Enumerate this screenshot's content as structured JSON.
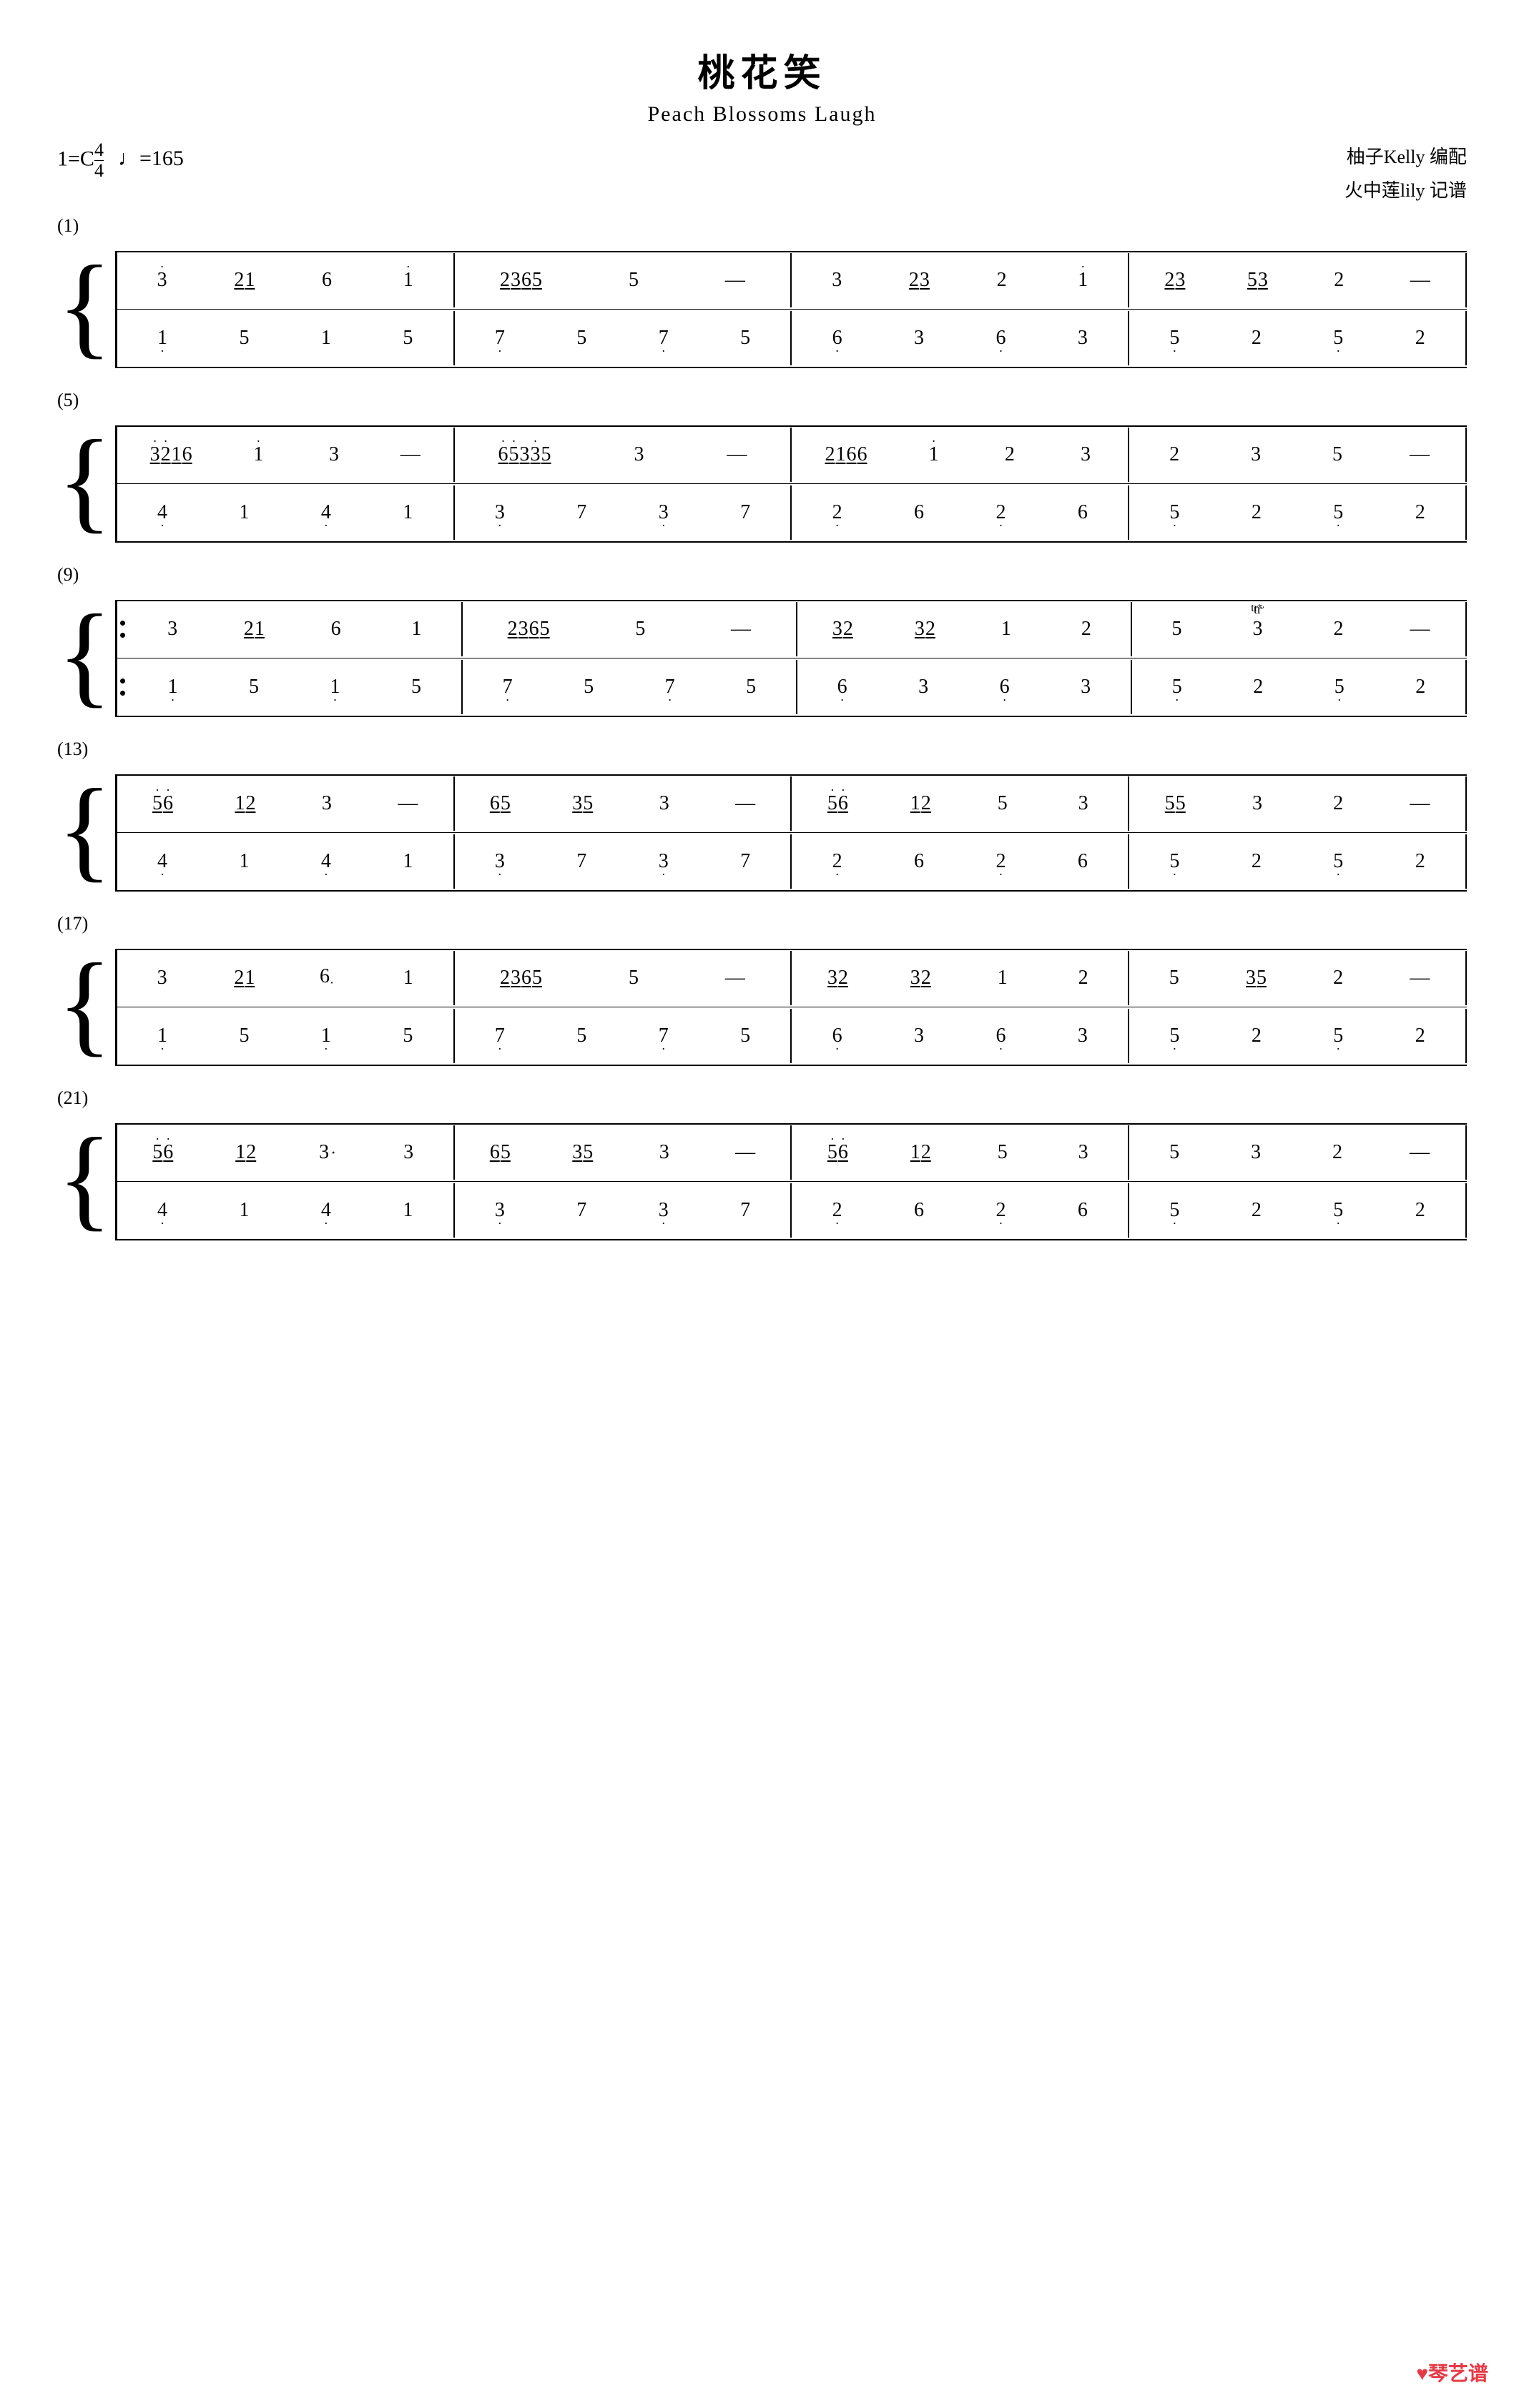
{
  "title": {
    "chinese": "桃花笑",
    "english": "Peach Blossoms Laugh",
    "key": "1=C",
    "time_num": "4",
    "time_den": "4",
    "tempo": "♩=165",
    "arranger": "柚子Kelly 编配",
    "transcriber": "火中莲lily 记谱"
  },
  "sections": [
    {
      "label": "(1)",
      "treble": [
        [
          "3·",
          "2̲1̲",
          "6",
          "1·",
          "|",
          "2̲3̲6̲5̲",
          "5",
          "—",
          "|",
          "3",
          "2̲3̲",
          "2",
          "1·",
          "|",
          "2̲3̲",
          "5̲3̲",
          "2",
          "—"
        ],
        [
          "1̣",
          "5",
          "1",
          "5",
          "|",
          "7̣",
          "5",
          "7̣",
          "5",
          "|",
          "6̣",
          "3",
          "6̣",
          "3",
          "|",
          "5̣",
          "2",
          "5̣",
          "2"
        ]
      ],
      "bass": [
        [
          "1̣",
          "5",
          "1",
          "5",
          "|",
          "7̣",
          "5",
          "7̣",
          "5",
          "|",
          "6̣",
          "3",
          "6̣",
          "3",
          "|",
          "5̣",
          "2",
          "5̣",
          "2"
        ]
      ]
    }
  ],
  "logo": "♥琴艺谱"
}
